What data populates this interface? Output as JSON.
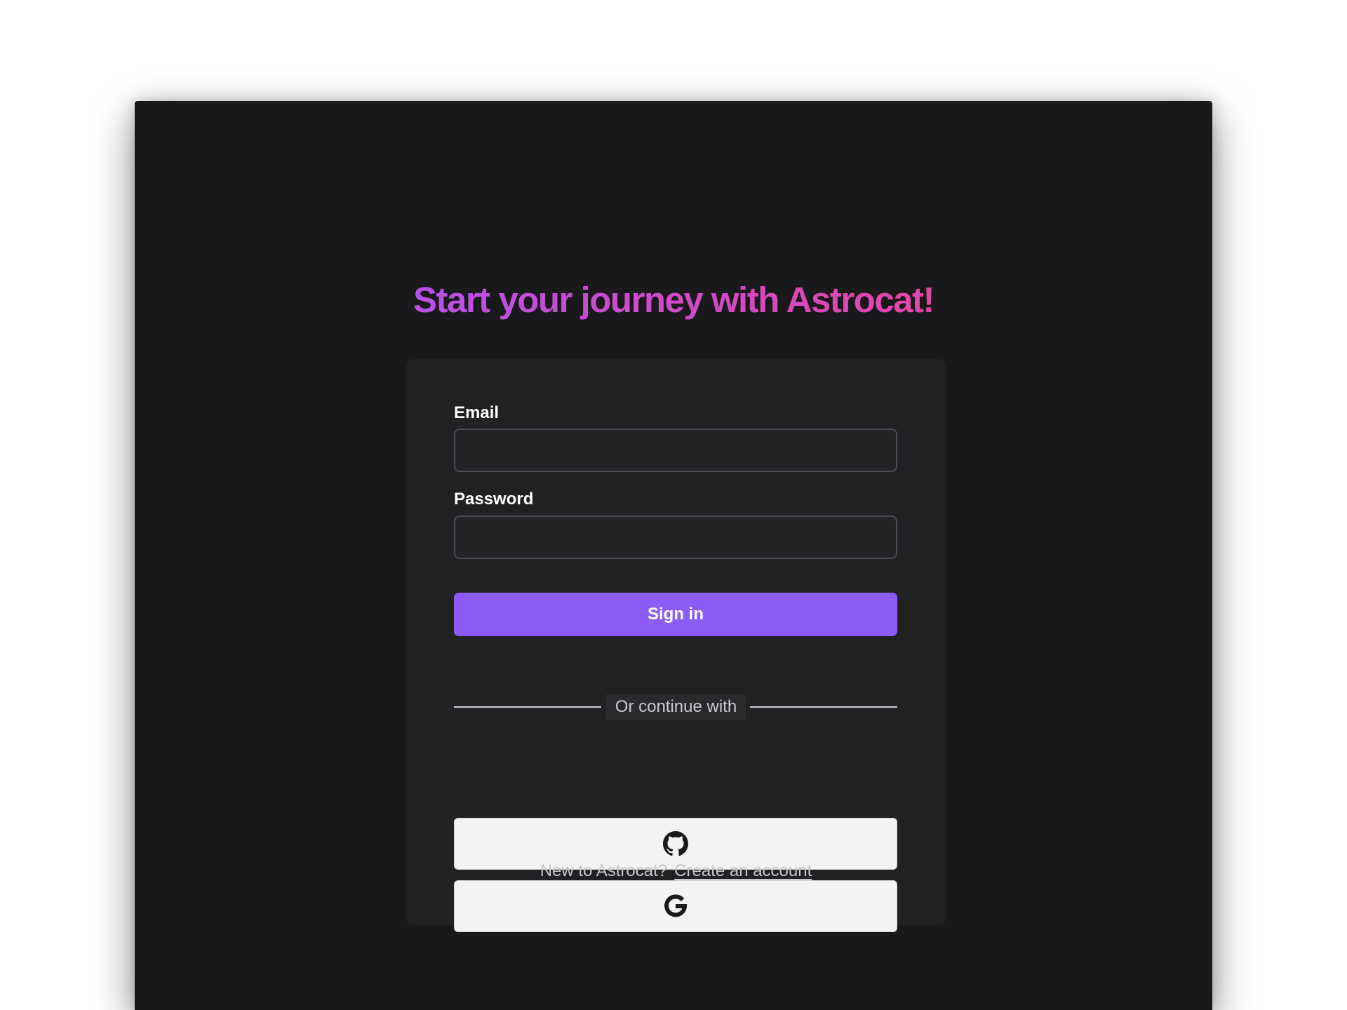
{
  "header": {
    "title": "Start your journey with Astrocat!"
  },
  "form": {
    "email_label": "Email",
    "email_value": "",
    "password_label": "Password",
    "password_value": "",
    "sign_in_label": "Sign in",
    "divider_text": "Or continue with"
  },
  "oauth": [
    {
      "provider": "GitHub",
      "icon": "github-icon"
    },
    {
      "provider": "Google",
      "icon": "google-icon"
    }
  ],
  "footer": {
    "prompt": "New to Astrocat?",
    "link_label": "Create an account"
  },
  "colors": {
    "background": "#19191b",
    "card": "#212123",
    "accent": "#8b5cf6",
    "title_gradient_start": "#b950e8",
    "title_gradient_end": "#e445a8"
  }
}
